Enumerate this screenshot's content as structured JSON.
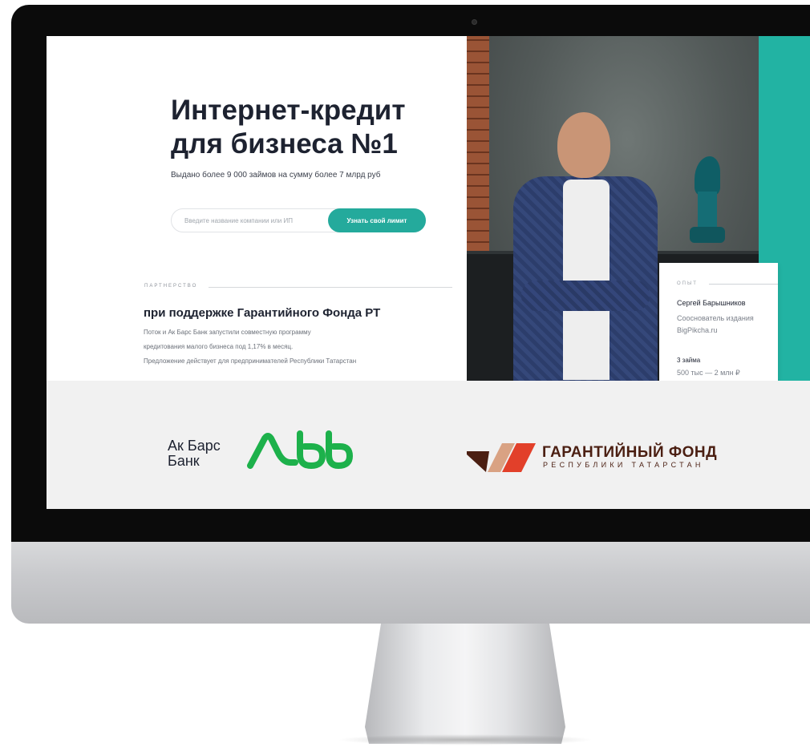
{
  "hero": {
    "title_line1": "Интернет-кредит",
    "title_line2": "для бизнеса №1",
    "subtitle": "Выдано более 9 000 займов на сумму более 7 млрд руб"
  },
  "search": {
    "placeholder": "Введите название компании или ИП",
    "button_label": "Узнать свой лимит"
  },
  "partnership": {
    "label": "ПАРТНЕРСТВО",
    "title": "при поддержке Гарантийного Фонда РТ",
    "description_line1": "Поток и Ак Барс Банк запустили совместную программу",
    "description_line2": "кредитования малого бизнеса под 1,17% в месяц.",
    "description_line3": "Предложение действует для предпринимателей Республики Татарстан"
  },
  "testimonial": {
    "label": "ОПЫТ",
    "name": "Сергей Барышников",
    "role": "Сооснователь издания BigPikcha.ru",
    "loans": "3 займа",
    "range": "500 тыс — 2 млн ₽"
  },
  "logos": {
    "akbars_line1": "Ак Барс",
    "akbars_line2": "Банк",
    "gf_name": "ГАРАНТИЙНЫЙ ФОНД",
    "gf_sub": "РЕСПУБЛИКИ ТАТАРСТАН"
  },
  "colors": {
    "accent": "#24aa9c",
    "teal_strip": "#22b3a3",
    "akbars_green": "#1db14b",
    "gf_red": "#e2402a",
    "gf_brown": "#4b1f12"
  }
}
